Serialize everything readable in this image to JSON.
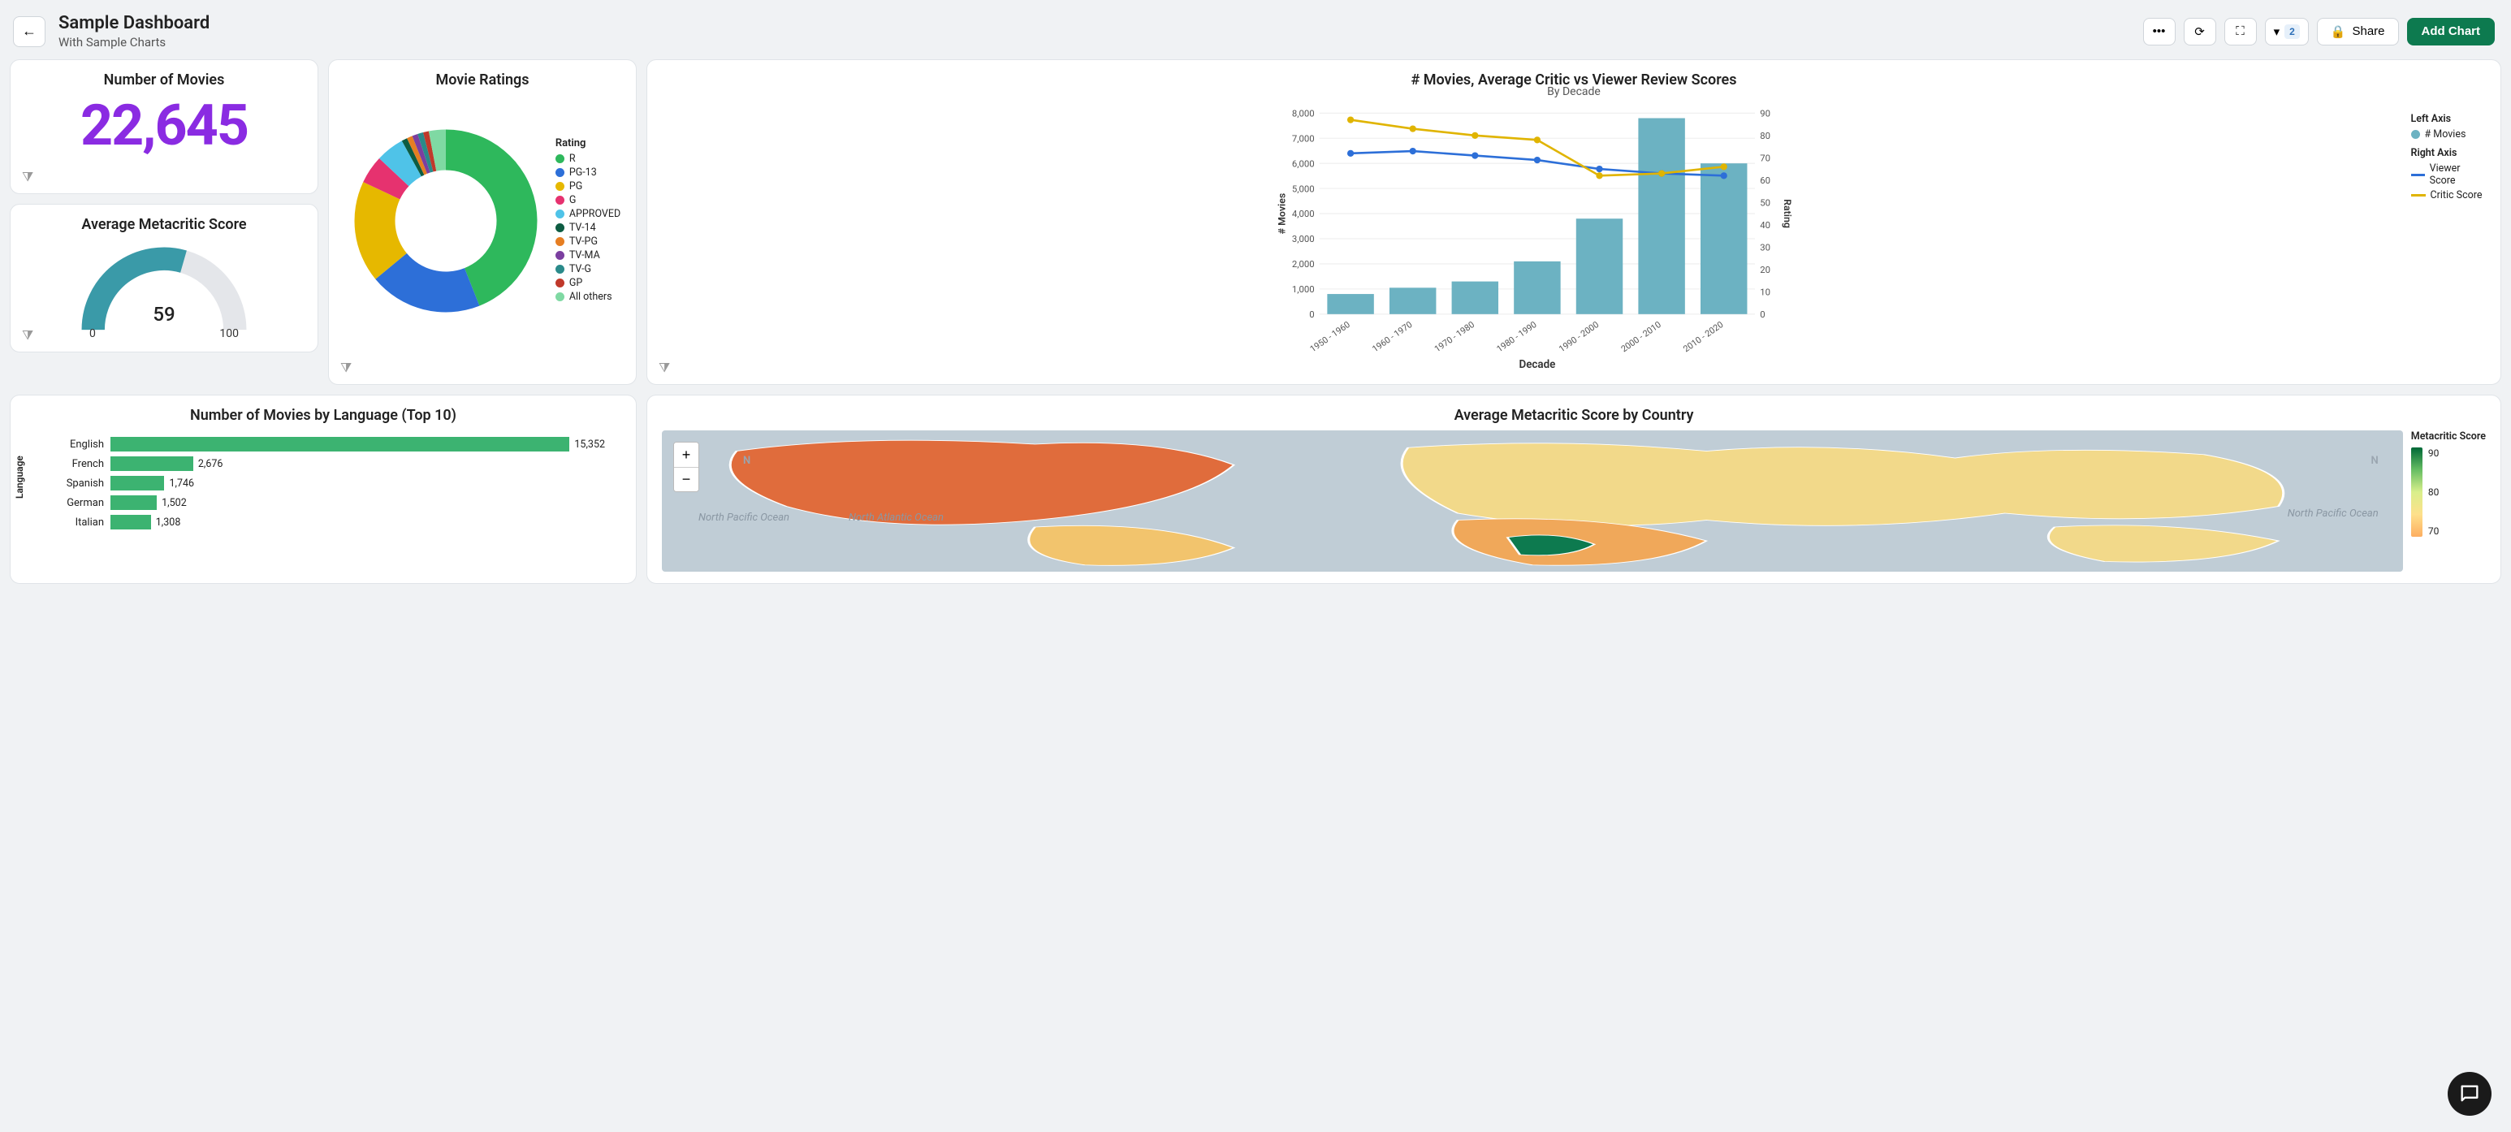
{
  "header": {
    "title": "Sample Dashboard",
    "subtitle": "With Sample Charts",
    "filter_count": "2",
    "share_label": "Share",
    "add_chart_label": "Add Chart"
  },
  "kpi": {
    "title": "Number of Movies",
    "value": "22,645"
  },
  "gauge": {
    "title": "Average Metacritic Score",
    "value": "59",
    "min": "0",
    "max": "100"
  },
  "donut_card": {
    "title": "Movie Ratings",
    "legend_title": "Rating"
  },
  "combo_card": {
    "title": "# Movies, Average Critic vs Viewer Review Scores",
    "subtitle": "By Decade",
    "left_axis_label": "# Movies",
    "right_axis_label": "Rating",
    "x_axis_label": "Decade",
    "left_legend_header": "Left Axis",
    "right_legend_header": "Right Axis",
    "series_movies": "# Movies",
    "series_viewer": "Viewer Score",
    "series_critic": "Critic Score"
  },
  "hbar_card": {
    "title": "Number of Movies by Language (Top 10)",
    "ylabel": "Language"
  },
  "map_card": {
    "title": "Average Metacritic Score by Country",
    "legend_title": "Metacritic Score",
    "legend_ticks": [
      "90",
      "80",
      "70"
    ],
    "ocean_labels": [
      "North Pacific Ocean",
      "North Atlantic Ocean",
      "North Pacific Ocean"
    ],
    "compass": "N"
  },
  "chart_data": [
    {
      "id": "movie_ratings_donut",
      "type": "pie",
      "title": "Movie Ratings",
      "categories": [
        "R",
        "PG-13",
        "PG",
        "G",
        "APPROVED",
        "TV-14",
        "TV-PG",
        "TV-MA",
        "TV-G",
        "GP",
        "All others"
      ],
      "values": [
        44,
        20,
        18,
        5,
        5,
        1,
        1,
        1,
        1,
        1,
        3
      ],
      "colors": [
        "#2eb85c",
        "#2d6fd8",
        "#e6b800",
        "#e6326f",
        "#4fc3e8",
        "#0d5c42",
        "#e67e22",
        "#7b3fa0",
        "#2a8a8a",
        "#c0392b",
        "#7fd9a3"
      ]
    },
    {
      "id": "movies_by_decade_combo",
      "type": "bar",
      "title": "# Movies, Average Critic vs Viewer Review Scores",
      "categories": [
        "1950 - 1960",
        "1960 - 1970",
        "1970 - 1980",
        "1980 - 1990",
        "1990 - 2000",
        "2000 - 2010",
        "2010 - 2020"
      ],
      "series": [
        {
          "name": "# Movies",
          "axis": "left",
          "type": "bar",
          "values": [
            800,
            1050,
            1300,
            2100,
            3800,
            7800,
            6000
          ],
          "color": "#6cb2c2"
        },
        {
          "name": "Viewer Score",
          "axis": "right",
          "type": "line",
          "values": [
            72,
            73,
            71,
            69,
            65,
            63,
            62
          ],
          "color": "#2d6fd8"
        },
        {
          "name": "Critic Score",
          "axis": "right",
          "type": "line",
          "values": [
            87,
            83,
            80,
            78,
            62,
            63,
            66
          ],
          "color": "#e0b400"
        }
      ],
      "y_left": {
        "label": "# Movies",
        "min": 0,
        "max": 8000,
        "ticks": [
          0,
          1000,
          2000,
          3000,
          4000,
          5000,
          6000,
          7000,
          8000
        ]
      },
      "y_right": {
        "label": "Rating",
        "min": 0,
        "max": 90,
        "ticks": [
          0,
          10,
          20,
          30,
          40,
          50,
          60,
          70,
          80,
          90
        ]
      },
      "xlabel": "Decade"
    },
    {
      "id": "movies_by_language_hbar",
      "type": "bar",
      "orientation": "horizontal",
      "title": "Number of Movies by Language (Top 10)",
      "categories": [
        "English",
        "French",
        "Spanish",
        "German",
        "Italian"
      ],
      "values": [
        15352,
        2676,
        1746,
        1502,
        1308
      ],
      "xlim": [
        0,
        16000
      ],
      "color": "#3cb371",
      "ylabel": "Language"
    },
    {
      "id": "metacritic_by_country_map",
      "type": "heatmap",
      "title": "Average Metacritic Score by Country",
      "legend": {
        "label": "Metacritic Score",
        "ticks": [
          70,
          80,
          90
        ]
      }
    }
  ]
}
